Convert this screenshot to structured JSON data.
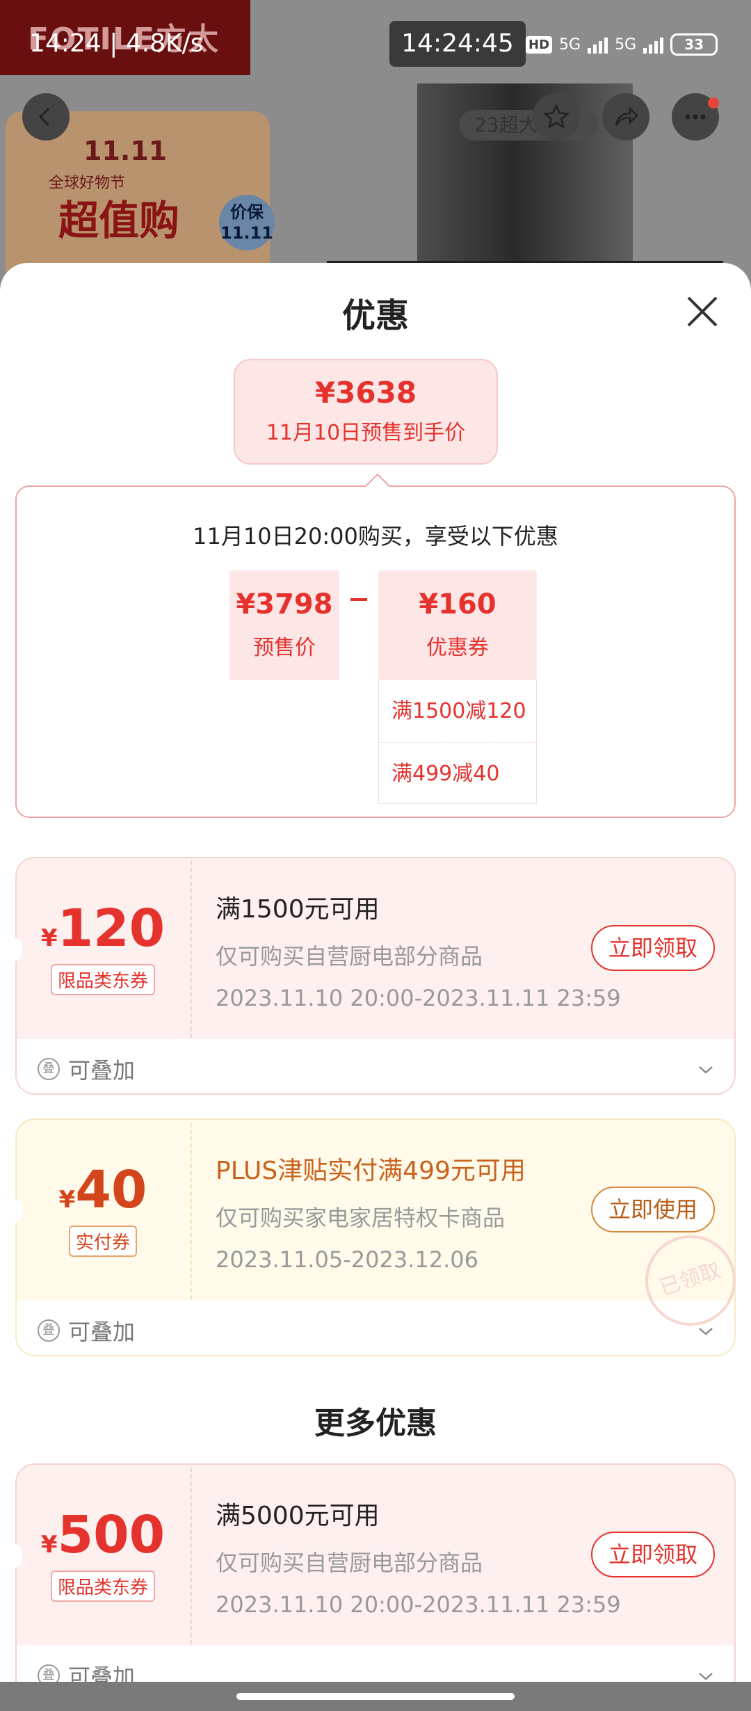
{
  "status_bar": {
    "time_speed": "14:24 | 4.8K/s",
    "clock": "14:24:45",
    "hd": "HD",
    "net1": "5G",
    "net2": "5G",
    "battery": "33"
  },
  "background": {
    "brand": "FOTILE方太",
    "promo_top": "11.11",
    "promo_sub": "全球好物节",
    "promo_big": "超值购",
    "promo_badge": "价保 11.11",
    "chip": "23超大"
  },
  "sheet": {
    "title": "优惠",
    "price_bubble": {
      "price": "¥3638",
      "label": "11月10日预售到手价"
    },
    "calc": {
      "heading": "11月10日20:00购买，享受以下优惠",
      "presale_value": "¥3798",
      "presale_label": "预售价",
      "coupon_value": "¥160",
      "coupon_label": "优惠券",
      "coupon_items": [
        "满1500减120",
        "满499减40"
      ]
    },
    "coupons": [
      {
        "yen": "¥",
        "amount": "120",
        "tag": "限品类东券",
        "title": "满1500元可用",
        "desc": "仅可购买自营厨电部分商品",
        "validity": "2023.11.10 20:00-2023.11.11 23:59",
        "action": "立即领取",
        "stack_icon": "叠",
        "stack": "可叠加"
      },
      {
        "yen": "¥",
        "amount": "40",
        "tag": "实付券",
        "title": "PLUS津贴实付满499元可用",
        "desc": "仅可购买家电家居特权卡商品",
        "validity": "2023.11.05-2023.12.06",
        "action": "立即使用",
        "stamp": "已领取",
        "stack_icon": "叠",
        "stack": "可叠加"
      }
    ],
    "more_title": "更多优惠",
    "more_coupons": [
      {
        "yen": "¥",
        "amount": "500",
        "tag": "限品类东券",
        "title": "满5000元可用",
        "desc": "仅可购买自营厨电部分商品",
        "validity": "2023.11.10 20:00-2023.11.11 23:59",
        "action": "立即领取",
        "stack_icon": "叠",
        "stack": "可叠加"
      }
    ]
  },
  "colors": {
    "accent_red": "#e5322d",
    "gold_text": "#c9621b"
  }
}
